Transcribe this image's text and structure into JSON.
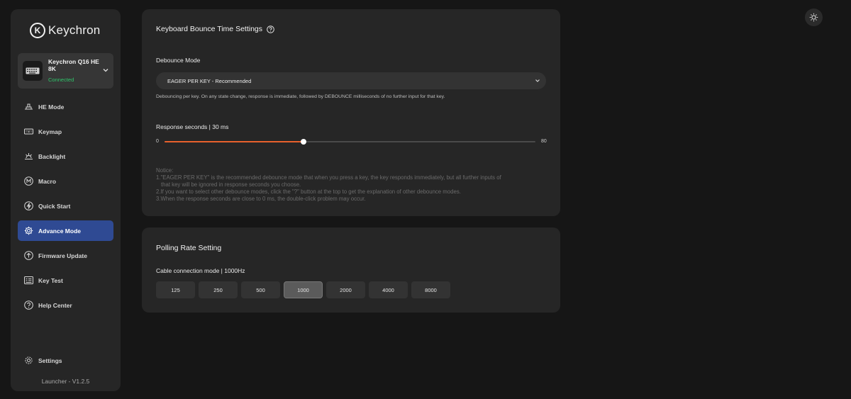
{
  "brand": {
    "name": "Keychron",
    "logo_letter": "K"
  },
  "device": {
    "name": "Keychron Q16 HE 8K",
    "status": "Connected",
    "status_color": "#2fc46a"
  },
  "nav": {
    "items": [
      {
        "label": "HE Mode",
        "icon": "he-mode-icon"
      },
      {
        "label": "Keymap",
        "icon": "keyboard-icon"
      },
      {
        "label": "Backlight",
        "icon": "backlight-icon"
      },
      {
        "label": "Macro",
        "icon": "macro-icon"
      },
      {
        "label": "Quick Start",
        "icon": "lightning-icon"
      },
      {
        "label": "Advance Mode",
        "icon": "gear-icon",
        "active": true
      },
      {
        "label": "Firmware Update",
        "icon": "upload-icon"
      },
      {
        "label": "Key Test",
        "icon": "key-test-icon"
      },
      {
        "label": "Help Center",
        "icon": "help-icon"
      }
    ],
    "settings": "Settings",
    "version": "Launcher - V1.2.5"
  },
  "bounce": {
    "title": "Keyboard Bounce Time Settings",
    "mode_label": "Debounce Mode",
    "mode_value": "EAGER PER KEY - Recommended",
    "mode_description": "Debouncing per key. On any state change, response is immediate, followed by DEBOUNCE milliseconds of no further input for that key.",
    "response_label": "Response seconds | 30 ms",
    "slider": {
      "min": "0",
      "max": "80",
      "value": 30,
      "min_value": 0,
      "max_value": 80
    },
    "notice": {
      "heading": "Notice:",
      "line1": "1.\"EAGER PER KEY\" is the recommended debounce mode that when you press a key, the key responds immediately, but all further inputs of",
      "line1b": "that key will be ignored in response seconds you choose.",
      "line2": "2.If you want to select other debounce modes, click the \"?\" button at the top to get the explanation of other debounce modes.",
      "line3": "3.When the response seconds are close to 0 ms, the double-click problem may occur."
    }
  },
  "polling": {
    "title": "Polling Rate Setting",
    "mode_label": "Cable connection mode | 1000Hz",
    "rates": [
      "125",
      "250",
      "500",
      "1000",
      "2000",
      "4000",
      "8000"
    ],
    "selected": "1000"
  },
  "colors": {
    "accent": "#2f4a93",
    "slider": "#e8602c",
    "background": "#161616",
    "panel": "#262626"
  }
}
